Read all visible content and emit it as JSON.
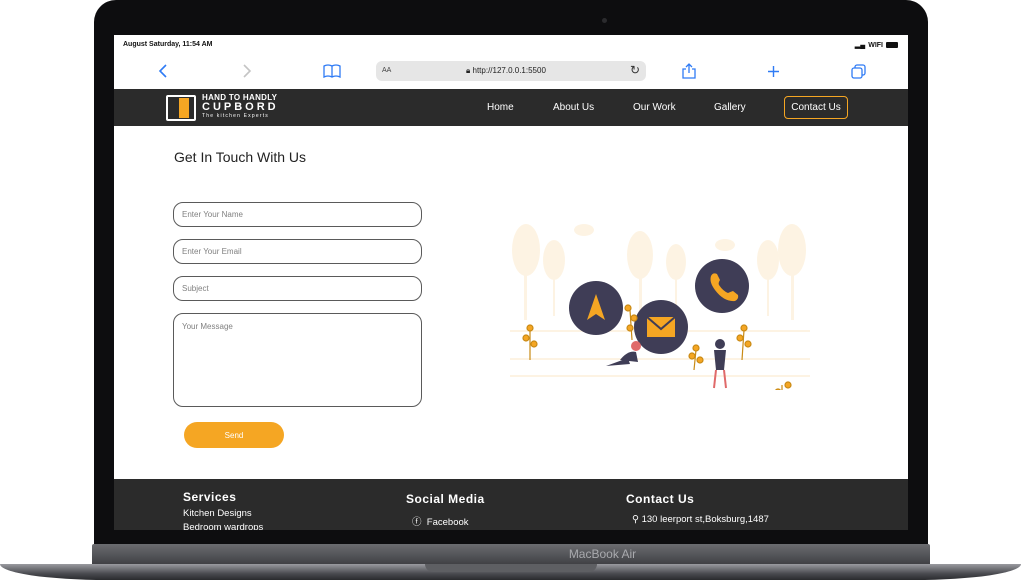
{
  "device": {
    "label": "MacBook Air"
  },
  "status_bar": {
    "time": "August Saturday, 11:54 AM",
    "signal": "WIFI"
  },
  "browser": {
    "text_size": "AA",
    "url": "http://127.0.0.1:5500"
  },
  "site": {
    "logo": {
      "line1": "HAND TO HANDLY",
      "line2": "CUPBORD",
      "tagline": "The kitchen Experts"
    },
    "nav": [
      {
        "label": "Home"
      },
      {
        "label": "About Us"
      },
      {
        "label": "Our Work"
      },
      {
        "label": "Gallery"
      },
      {
        "label": "Contact Us"
      }
    ]
  },
  "contact_form": {
    "heading": "Get In Touch With Us",
    "name_placeholder": "Enter Your Name",
    "email_placeholder": "Enter Your Email",
    "subject_placeholder": "Subject",
    "message_placeholder": "Your Message",
    "send_label": "Send"
  },
  "footer": {
    "services": {
      "heading": "Services",
      "items": [
        "Kitchen Designs",
        "Bedroom wardrops"
      ]
    },
    "social": {
      "heading": "Social Media",
      "facebook": "Facebook"
    },
    "contact": {
      "heading": "Contact Us",
      "address": "130 leerport st,Boksburg,1487"
    }
  },
  "colors": {
    "accent": "#f5a623",
    "nav_bg": "#2b2b2b",
    "illustration_circle": "#3f3d56",
    "browser_blue": "#2f7bf5"
  }
}
